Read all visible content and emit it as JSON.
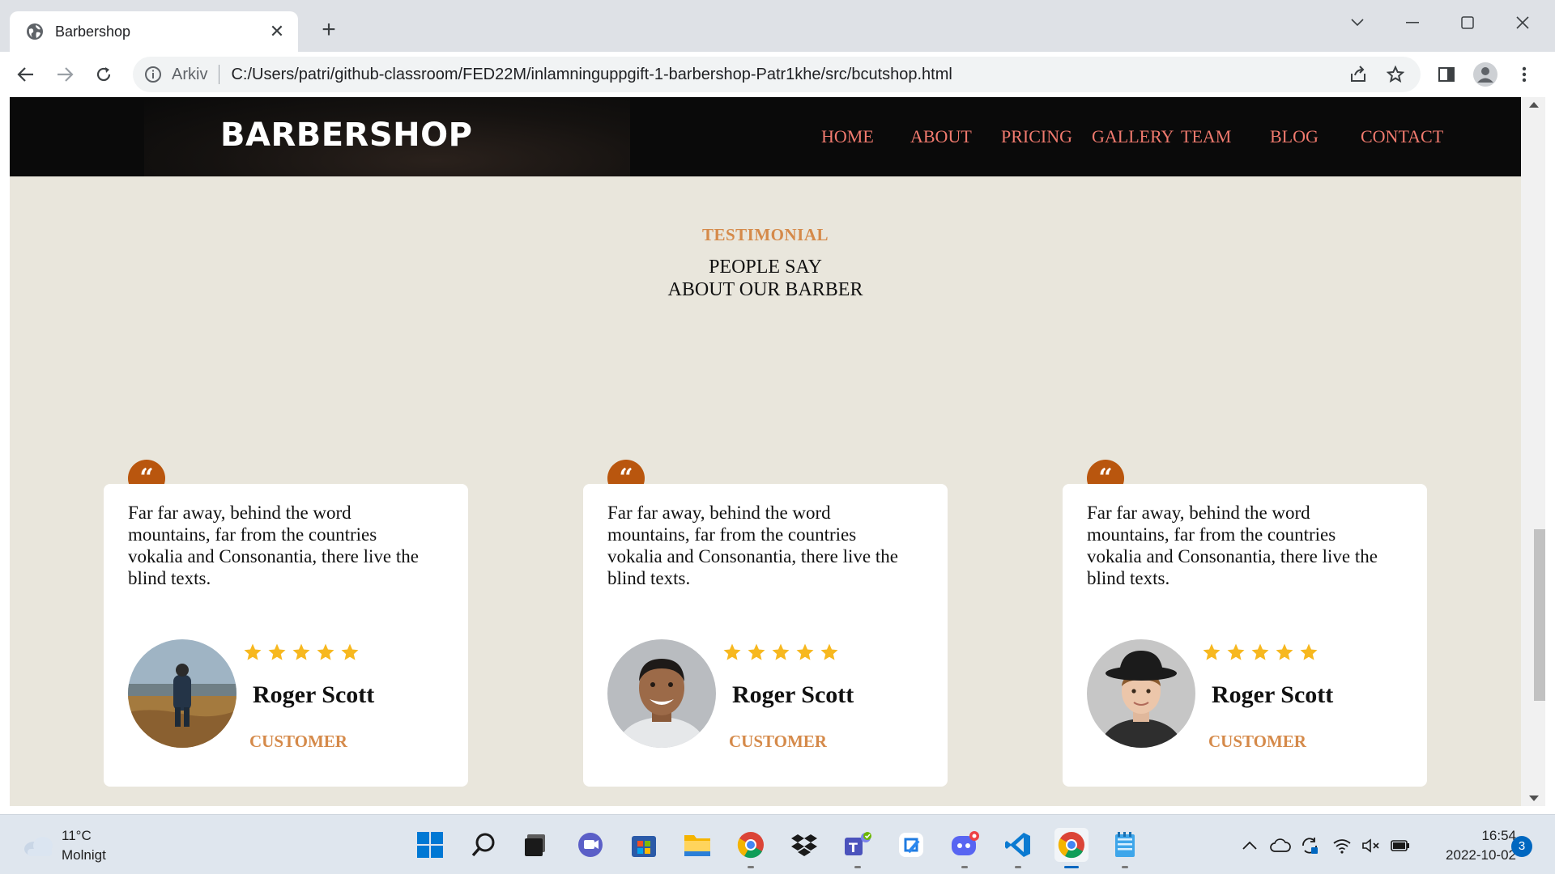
{
  "browser": {
    "tab_title": "Barbershop",
    "new_tab_label": "+",
    "close_tab_label": "✕",
    "security_label": "Arkiv",
    "url": "C:/Users/patri/github-classroom/FED22M/inlamninguppgift-1-barbershop-Patr1khe/src/bcutshop.html"
  },
  "site": {
    "brand": "BARBERSHOP",
    "nav": [
      "HOME",
      "ABOUT",
      "PRICING",
      "GALLERY",
      "TEAM",
      "BLOG",
      "CONTACT"
    ],
    "nav_color": "#f07a6e"
  },
  "testimonial": {
    "subheading": "TESTIMONIAL",
    "title_line1": "PEOPLE SAY",
    "title_line2": "ABOUT OUR BARBER",
    "accent_color": "#d58a4a",
    "badge_color": "#b9560e",
    "cards": [
      {
        "quote_icon": "quote-icon",
        "text": "Far far away, behind the word mountains, far from the countries vokalia and Consonantia, there live the blind texts.",
        "rating": 5,
        "name": "Roger Scott",
        "role": "CUSTOMER",
        "avatar": "avatar-man-in-field"
      },
      {
        "quote_icon": "quote-icon",
        "text": "Far far away, behind the word mountains, far from the countries vokalia and Consonantia, there live the blind texts.",
        "rating": 5,
        "name": "Roger Scott",
        "role": "CUSTOMER",
        "avatar": "avatar-smiling-man"
      },
      {
        "quote_icon": "quote-icon",
        "text": "Far far away, behind the word mountains, far from the countries vokalia and Consonantia, there live the blind texts.",
        "rating": 5,
        "name": "Roger Scott",
        "role": "CUSTOMER",
        "avatar": "avatar-young-man-hat"
      }
    ]
  },
  "taskbar": {
    "weather_temp": "11°C",
    "weather_desc": "Molnigt",
    "time": "16:54",
    "date": "2022-10-02",
    "notifications": "3",
    "apps": [
      "start-icon",
      "search-icon",
      "task-view-icon",
      "chat-icon",
      "store-icon",
      "file-explorer-icon",
      "chrome-icon",
      "dropbox-icon",
      "teams-icon",
      "snip-icon",
      "discord-icon",
      "vscode-icon",
      "chrome-active-icon",
      "notepad-icon"
    ]
  }
}
